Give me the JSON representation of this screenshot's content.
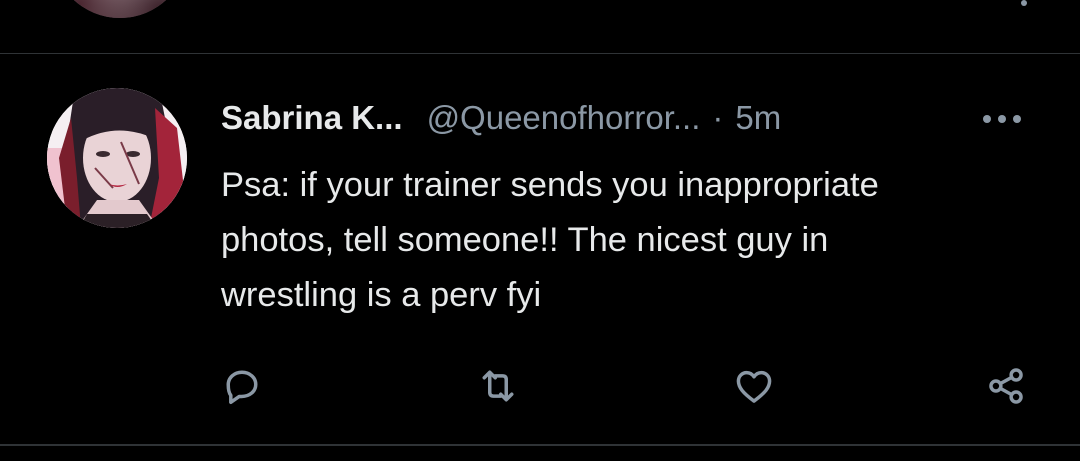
{
  "tweet": {
    "display_name": "Sabrina K...",
    "handle": "@Queenofhorror...",
    "separator": "·",
    "time": "5m",
    "text": "Psa: if your trainer sends you inappropriate\nphotos, tell someone!! The nicest guy in\nwrestling is a perv fyi"
  },
  "actions": {
    "reply": "reply-icon",
    "retweet": "retweet-icon",
    "like": "heart-icon",
    "share": "share-icon"
  },
  "colors": {
    "background": "#000000",
    "text_primary": "#e7e9ea",
    "text_secondary": "#8b98a5",
    "divider": "#2f3336"
  }
}
